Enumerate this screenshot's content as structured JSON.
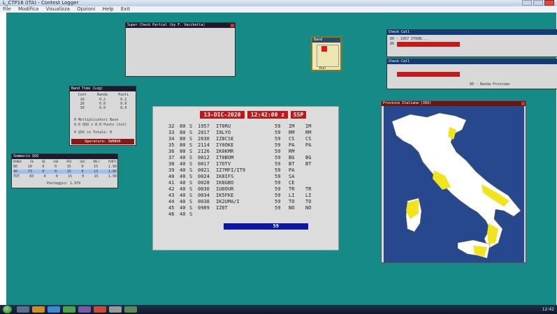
{
  "window": {
    "title": "L_CTP16 (ITA) - Contest Logger",
    "menu": [
      "File",
      "Modifica",
      "Visualizza",
      "Opzioni",
      "Help",
      "Exit"
    ]
  },
  "superdupe": {
    "title": "Super Check Partial (by F. Vacchetta)"
  },
  "band_panel": {
    "title": "Band",
    "run_label": "Run"
  },
  "check_cw": {
    "title": "Check Call",
    "row1": "80 - 1957 IT0ON...",
    "row2": "80"
  },
  "check_ssb": {
    "title": "Check Call",
    "legend": "80 - Banda Prossima"
  },
  "band_time": {
    "title": "Band Time (Log)",
    "headers": [
      "Cont",
      "Banda",
      "Punti"
    ],
    "rows": [
      [
        "10",
        "0.2",
        "0.2"
      ],
      [
        "20",
        "0.0",
        "0.0"
      ],
      [
        "30",
        "0.0",
        "0.0"
      ]
    ],
    "line1": "0 Moltiplicatori Base",
    "line2": "0.0 QSO x 0.0 Punto (tot)",
    "line3": "0 QSO in Totale: 0",
    "operator": "Operatore: IW0BOK"
  },
  "summary": {
    "title": "Sommario QSO",
    "headers": [
      "BANDA",
      "CW",
      "SB",
      "SSB",
      "MIX",
      "QSO",
      "MULT",
      "PUNTI"
    ],
    "rows": [
      [
        "80",
        "10",
        "0",
        "0",
        "15",
        "0",
        "15",
        "1.90"
      ],
      [
        "40",
        "73",
        "0",
        "0",
        "15",
        "0",
        "13",
        "1.90"
      ],
      [
        "TOT",
        "83",
        "0",
        "0",
        "15",
        "0",
        "15",
        "1.90"
      ]
    ],
    "footer": "Punteggio: 1.979"
  },
  "main_log": {
    "date": "13-DIC-2020",
    "time": "12:42:00 z",
    "mode": "SSP",
    "rows": [
      [
        "32",
        "80",
        "S",
        "1957",
        "IT0RU",
        "59",
        "IM",
        "IM"
      ],
      [
        "33",
        "80",
        "S",
        "2017",
        "I0LYO",
        "59",
        "RM",
        "RM"
      ],
      [
        "34",
        "80",
        "S",
        "2030",
        "IZ8CSE",
        "59",
        "CS",
        "CS"
      ],
      [
        "35",
        "80",
        "S",
        "2114",
        "IY0OKE",
        "59",
        "PA",
        "PA"
      ],
      [
        "36",
        "80",
        "S",
        "2126",
        "IK0KMR",
        "59",
        "RM",
        ""
      ],
      [
        "37",
        "40",
        "S",
        "0012",
        "IT0BOM",
        "59",
        "BG",
        "BG"
      ],
      [
        "38",
        "40",
        "S",
        "0017",
        "I7OTV",
        "59",
        "BT",
        "BT"
      ],
      [
        "39",
        "40",
        "S",
        "0021",
        "IZ7MFI/IT9",
        "59",
        "PA",
        ""
      ],
      [
        "40",
        "40",
        "S",
        "0024",
        "IK8IFS",
        "59",
        "SA",
        ""
      ],
      [
        "41",
        "40",
        "S",
        "0028",
        "IK8GBO",
        "59",
        "CE",
        ""
      ],
      [
        "42",
        "40",
        "S",
        "0030",
        "IU0OUR",
        "59",
        "TR",
        "TR"
      ],
      [
        "43",
        "40",
        "S",
        "0034",
        "IK5FKE",
        "59",
        "LI",
        "LI"
      ],
      [
        "44",
        "40",
        "S",
        "0038",
        "IK2UMA/I",
        "59",
        "TO",
        "TO"
      ],
      [
        "45",
        "40",
        "S",
        "0989",
        "IZ0T",
        "59",
        "NO",
        "NO"
      ],
      [
        "46",
        "40",
        "S",
        "",
        "",
        "",
        "",
        ""
      ]
    ],
    "cursor_value": "59"
  },
  "map": {
    "title": "Province Italiane (IKO)",
    "sea_color": "#28488d",
    "land_color": "#ffffff",
    "worked_color": "#f2e41c"
  },
  "taskbar": {
    "clock": "12:42"
  }
}
